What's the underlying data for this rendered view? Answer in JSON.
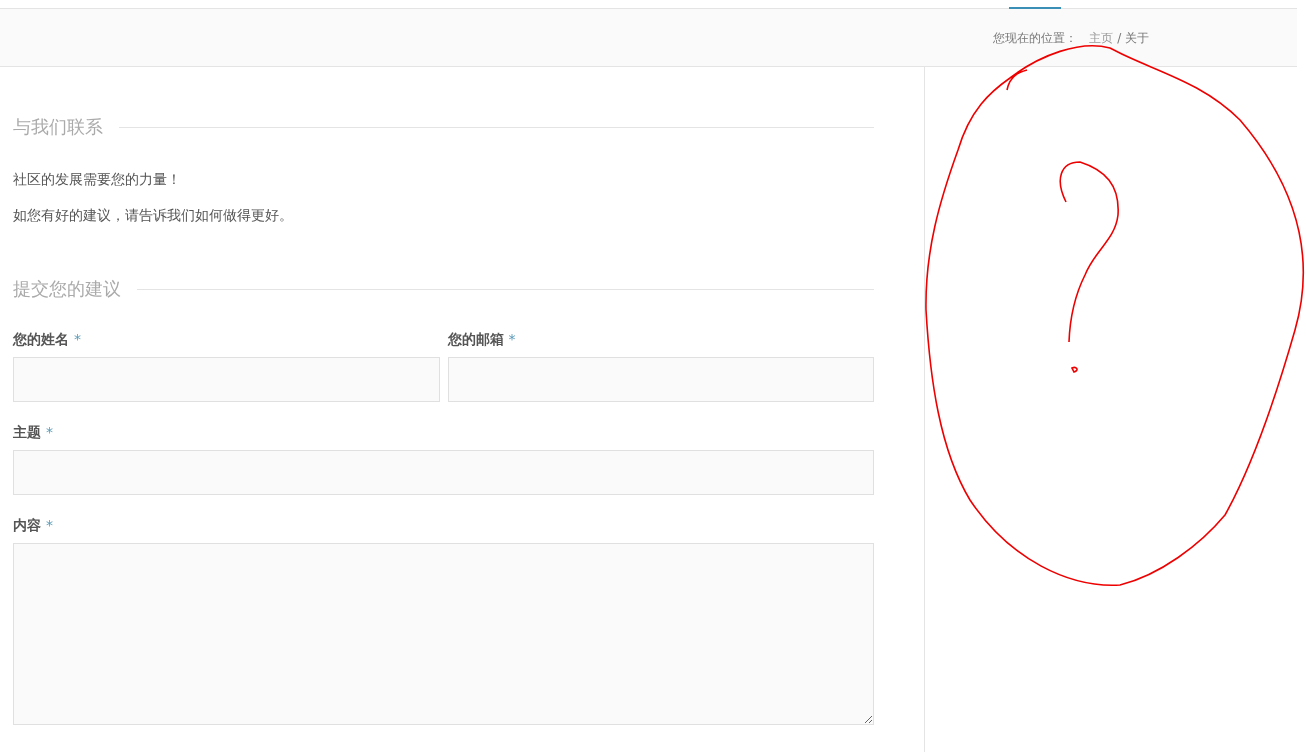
{
  "breadcrumb": {
    "prefix": "您现在的位置：",
    "home": "主页",
    "separator": "/",
    "current": "关于"
  },
  "contact": {
    "heading": "与我们联系",
    "paragraphs": [
      "社区的发展需要您的力量！",
      "如您有好的建议，请告诉我们如何做得更好。"
    ]
  },
  "form": {
    "heading": "提交您的建议",
    "fields": [
      {
        "kind": "half_input",
        "label": "您的姓名",
        "mark": "*"
      },
      {
        "kind": "half_input",
        "label": "您的邮箱",
        "mark": "*"
      },
      {
        "kind": "input",
        "label": "主题",
        "mark": "*"
      },
      {
        "kind": "textarea",
        "label": "内容",
        "mark": "*"
      }
    ]
  }
}
